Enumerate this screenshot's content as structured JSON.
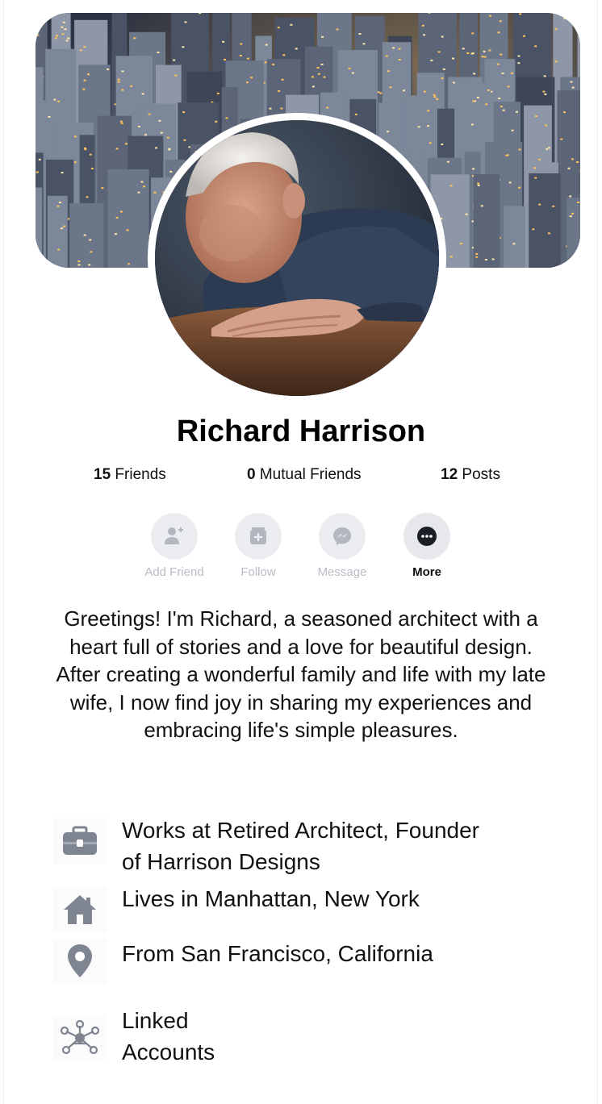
{
  "profile": {
    "name": "Richard Harrison"
  },
  "stats": {
    "friends_count": "15",
    "friends_label": " Friends",
    "mutual_count": "0",
    "mutual_label": " Mutual Friends",
    "posts_count": "12",
    "posts_label": " Posts"
  },
  "actions": {
    "add_friend": "Add Friend",
    "follow": "Follow",
    "message": "Message",
    "more": "More"
  },
  "bio": "Greetings! I'm Richard, a seasoned architect with a heart full of stories and a love for beautiful design. After creating a wonderful family and life with my late wife, I now find joy in sharing my experiences and embracing life's simple pleasures.",
  "info": {
    "work_line1": "Works at Retired Architect, Founder",
    "work_line2": "of Harrison Designs",
    "lives": "Lives in Manhattan, New York",
    "from": "From San Francisco, California",
    "linked_line1": "Linked",
    "linked_line2": "Accounts"
  },
  "colors": {
    "icon_gray": "#7e8591",
    "button_bg": "#e6e8ec",
    "button_label_disabled": "#b8bcc4",
    "text": "#111111"
  },
  "icons": {
    "work": "briefcase-icon",
    "home": "house-icon",
    "from": "location-pin-icon",
    "linked": "network-icon",
    "add_friend": "add-person-icon",
    "follow": "follow-icon",
    "message": "messenger-icon",
    "more": "more-dots-icon"
  }
}
